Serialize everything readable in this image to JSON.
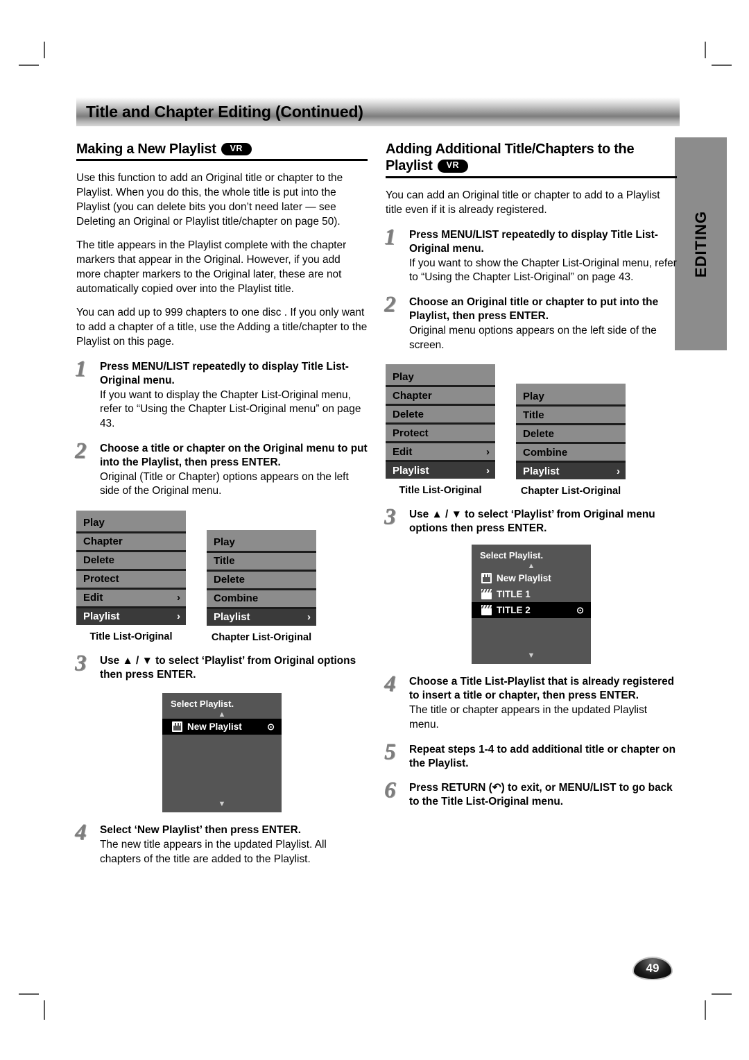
{
  "banner": {
    "title": "Title and Chapter Editing (Continued)"
  },
  "side_tab": {
    "label": "EDITING"
  },
  "page_number": "49",
  "badge": {
    "vr": "VR"
  },
  "left": {
    "heading": "Making a New Playlist",
    "paragraphs": [
      "Use this function to add an Original title or chapter to the Playlist. When you do this, the whole title is put into the Playlist (you can delete bits you don’t need later — see Deleting an Original or Playlist title/chapter on page 50).",
      "The title appears in the Playlist complete with the chapter markers that appear in the Original. However, if you add more chapter markers to the Original later, these are not automatically copied over into the Playlist title.",
      "You can add up to 999 chapters to one disc . If you only want to add a chapter of a title, use the Adding a title/chapter to the Playlist on this page."
    ],
    "steps": [
      {
        "num": "1",
        "lead": "Press MENU/LIST repeatedly to display Title List-Original menu.",
        "sub": "If you want to display the Chapter List-Original menu, refer to “Using the Chapter List-Original menu” on page 43."
      },
      {
        "num": "2",
        "lead": "Choose a title or chapter on the Original menu to put into the Playlist, then press ENTER.",
        "sub": "Original (Title or Chapter) options appears on the left side of the Original menu."
      },
      {
        "num": "3",
        "lead": "Use ▲ / ▼ to select ‘Playlist’ from Original options then press ENTER.",
        "sub": ""
      },
      {
        "num": "4",
        "lead": "Select ‘New Playlist’ then press ENTER.",
        "sub": "The new title appears in the updated Playlist. All chapters of the title are added to the Playlist."
      }
    ],
    "menus": [
      {
        "caption": "Title List-Original",
        "rows": [
          {
            "label": "Play",
            "arrow": "",
            "selected": false
          },
          {
            "label": "Chapter",
            "arrow": "",
            "selected": false
          },
          {
            "label": "Delete",
            "arrow": "",
            "selected": false
          },
          {
            "label": "Protect",
            "arrow": "",
            "selected": false
          },
          {
            "label": "Edit",
            "arrow": "›",
            "selected": false
          },
          {
            "label": "Playlist",
            "arrow": "›",
            "selected": true
          }
        ]
      },
      {
        "caption": "Chapter List-Original",
        "rows": [
          {
            "label": "Play",
            "arrow": "",
            "selected": false
          },
          {
            "label": "Title",
            "arrow": "",
            "selected": false
          },
          {
            "label": "Delete",
            "arrow": "",
            "selected": false
          },
          {
            "label": "Combine",
            "arrow": "",
            "selected": false
          },
          {
            "label": "Playlist",
            "arrow": "›",
            "selected": true
          }
        ]
      }
    ],
    "dialog": {
      "title": "Select Playlist.",
      "up_caret": "▲",
      "down_caret": "▼",
      "items": [
        {
          "icon": "note-icon",
          "label": "New Playlist",
          "dot": "⊙",
          "selected": true
        }
      ]
    }
  },
  "right": {
    "heading_line1": "Adding Additional Title/Chapters to the",
    "heading_line2": "Playlist",
    "paragraphs": [
      "You can add an Original title or chapter to add to a Playlist title even if it is already registered."
    ],
    "steps": [
      {
        "num": "1",
        "lead": "Press MENU/LIST repeatedly to display Title List-Original menu.",
        "sub": "If you want to show the Chapter List-Original menu, refer to “Using the Chapter List-Original” on page 43."
      },
      {
        "num": "2",
        "lead": "Choose an Original title or chapter to put into the Playlist, then press ENTER.",
        "sub": "Original menu options appears on the left side of the screen."
      },
      {
        "num": "3",
        "lead": "Use ▲ / ▼ to select ‘Playlist’ from Original menu options then press ENTER.",
        "sub": ""
      },
      {
        "num": "4",
        "lead": "Choose a Title List-Playlist that is already registered to insert a title or chapter, then press ENTER.",
        "sub": "The title or chapter appears in the updated Playlist menu."
      },
      {
        "num": "5",
        "lead": "Repeat steps 1-4 to add additional title or chapter on the Playlist.",
        "sub": ""
      },
      {
        "num": "6",
        "lead": "Press RETURN (↶) to exit, or MENU/LIST to go back to the Title List-Original menu.",
        "sub": ""
      }
    ],
    "menus": [
      {
        "caption": "Title List-Original",
        "rows": [
          {
            "label": "Play",
            "arrow": "",
            "selected": false
          },
          {
            "label": "Chapter",
            "arrow": "",
            "selected": false
          },
          {
            "label": "Delete",
            "arrow": "",
            "selected": false
          },
          {
            "label": "Protect",
            "arrow": "",
            "selected": false
          },
          {
            "label": "Edit",
            "arrow": "›",
            "selected": false
          },
          {
            "label": "Playlist",
            "arrow": "›",
            "selected": true
          }
        ]
      },
      {
        "caption": "Chapter List-Original",
        "rows": [
          {
            "label": "Play",
            "arrow": "",
            "selected": false
          },
          {
            "label": "Title",
            "arrow": "",
            "selected": false
          },
          {
            "label": "Delete",
            "arrow": "",
            "selected": false
          },
          {
            "label": "Combine",
            "arrow": "",
            "selected": false
          },
          {
            "label": "Playlist",
            "arrow": "›",
            "selected": true
          }
        ]
      }
    ],
    "dialog": {
      "title": "Select Playlist.",
      "up_caret": "▲",
      "down_caret": "▼",
      "items": [
        {
          "icon": "note-icon",
          "label": "New Playlist",
          "dot": "",
          "selected": false
        },
        {
          "icon": "clapper-icon",
          "label": "TITLE 1",
          "dot": "",
          "selected": false
        },
        {
          "icon": "clapper-icon",
          "label": "TITLE 2",
          "dot": "⊙",
          "selected": true
        }
      ]
    }
  }
}
